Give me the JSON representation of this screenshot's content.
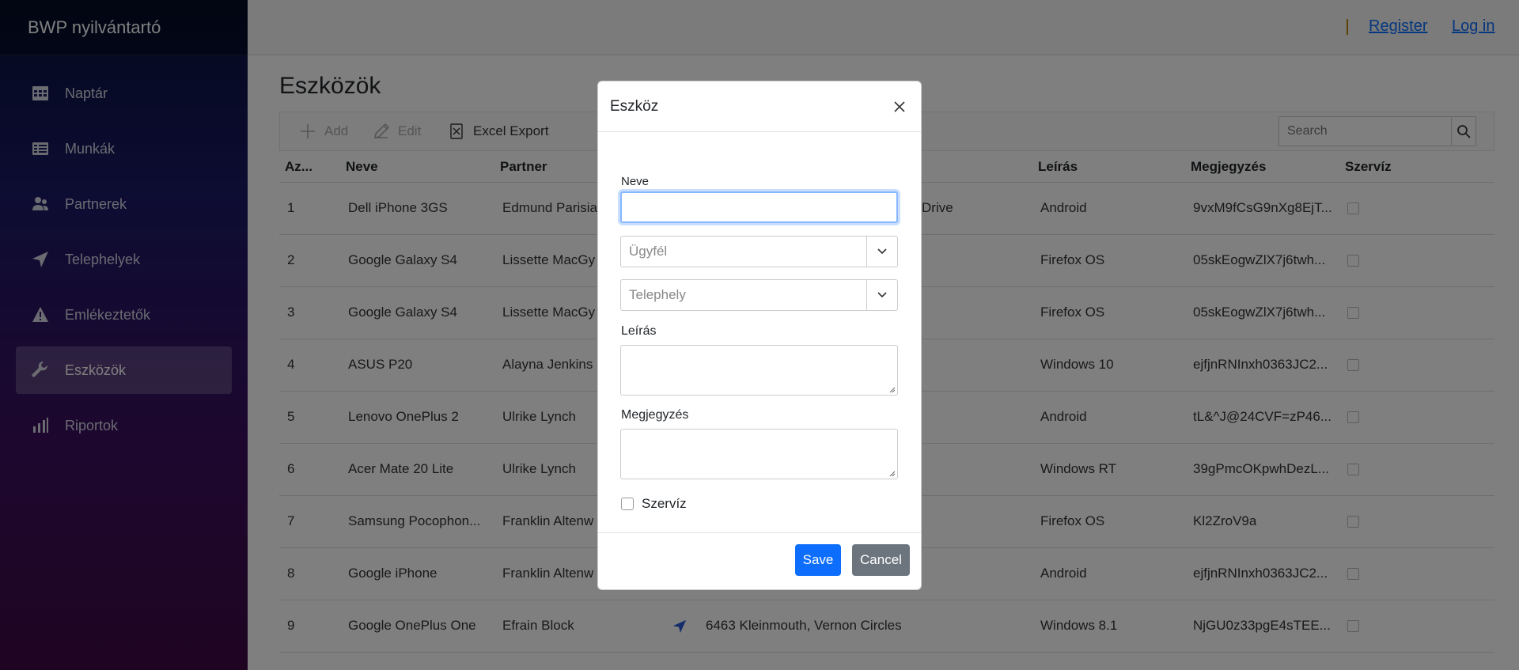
{
  "app": {
    "brand": "BWP nyilvántartó"
  },
  "sidebar": {
    "items": [
      {
        "label": "Naptár",
        "icon": "calendar-icon"
      },
      {
        "label": "Munkák",
        "icon": "list-icon"
      },
      {
        "label": "Partnerek",
        "icon": "users-icon"
      },
      {
        "label": "Telephelyek",
        "icon": "location-arrow-icon"
      },
      {
        "label": "Emlékeztetők",
        "icon": "warning-icon"
      },
      {
        "label": "Eszközök",
        "icon": "wrench-icon",
        "active": true
      },
      {
        "label": "Riportok",
        "icon": "bar-chart-icon"
      }
    ]
  },
  "header": {
    "register": "Register",
    "login": "Log in"
  },
  "page": {
    "title": "Eszközök"
  },
  "toolbar": {
    "add": "Add",
    "edit": "Edit",
    "excel": "Excel Export",
    "search_placeholder": "Search"
  },
  "table": {
    "columns": [
      "Az...",
      "Neve",
      "Partner",
      "Leírás",
      "Megjegyzés",
      "Szervíz"
    ],
    "rows": [
      {
        "id": "1",
        "name": "Dell iPhone 3GS",
        "partner": "Edmund Parisia",
        "site": "Drive",
        "desc": "Android",
        "note": "9vxM9fCsG9nXg8EjT...",
        "service": false
      },
      {
        "id": "2",
        "name": "Google Galaxy S4",
        "partner": "Lissette MacGy",
        "site": "",
        "desc": "Firefox OS",
        "note": "05skEogwZlX7j6twh...",
        "service": false
      },
      {
        "id": "3",
        "name": "Google Galaxy S4",
        "partner": "Lissette MacGy",
        "site": "",
        "desc": "Firefox OS",
        "note": "05skEogwZlX7j6twh...",
        "service": false
      },
      {
        "id": "4",
        "name": "ASUS P20",
        "partner": "Alayna Jenkins",
        "site": "",
        "desc": "Windows 10",
        "note": "ejfjnRNInxh0363JC2...",
        "service": false
      },
      {
        "id": "5",
        "name": "Lenovo OnePlus 2",
        "partner": "Ulrike Lynch",
        "site": "",
        "desc": "Android",
        "note": "tL&^J@24CVF=zP46...",
        "service": false
      },
      {
        "id": "6",
        "name": "Acer Mate 20 Lite",
        "partner": "Ulrike Lynch",
        "site": "",
        "desc": "Windows RT",
        "note": "39gPmcOKpwhDezL...",
        "service": false
      },
      {
        "id": "7",
        "name": "Samsung Pocophon...",
        "partner": "Franklin Altenw",
        "site": "",
        "desc": "Firefox OS",
        "note": "Kl2ZroV9a",
        "service": false
      },
      {
        "id": "8",
        "name": "Google iPhone",
        "partner": "Franklin Altenw",
        "site": "",
        "desc": "Android",
        "note": "ejfjnRNInxh0363JC2...",
        "service": false
      },
      {
        "id": "9",
        "name": "Google OnePlus One",
        "partner": "Efrain Block",
        "site": "6463 Kleinmouth, Vernon Circles",
        "desc": "Windows 8.1",
        "note": "NjGU0z33pgE4sTEE...",
        "service": false
      }
    ]
  },
  "modal": {
    "title": "Eszköz",
    "name_label": "Neve",
    "name_value": "",
    "client_placeholder": "Ügyfél",
    "site_placeholder": "Telephely",
    "desc_label": "Leírás",
    "note_label": "Megjegyzés",
    "service_label": "Szervíz",
    "save": "Save",
    "cancel": "Cancel"
  },
  "colors": {
    "primary": "#0d6efd",
    "secondary": "#6c757d",
    "link": "#0d6efd"
  }
}
